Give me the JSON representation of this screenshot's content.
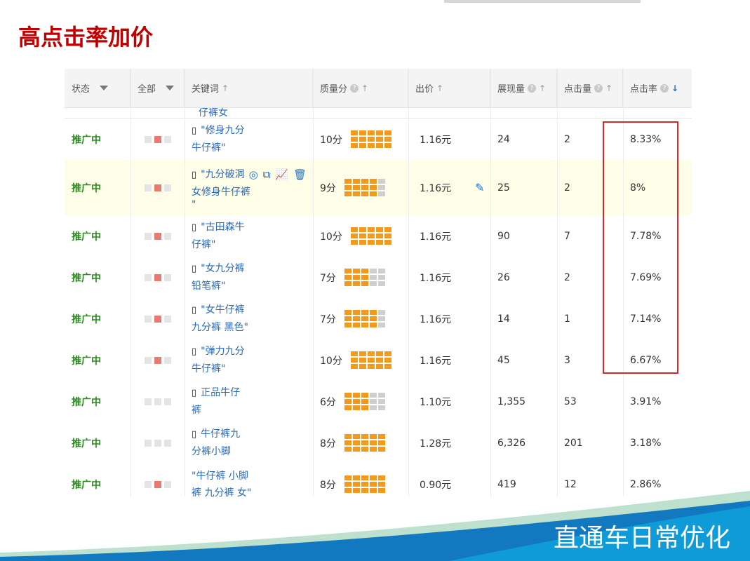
{
  "slide": {
    "title": "高点击率加价",
    "footer": "直通车日常优化"
  },
  "table": {
    "headers": {
      "status": "状态",
      "all": "全部",
      "keyword": "关键词",
      "quality": "质量分",
      "bid": "出价",
      "impressions": "展现量",
      "clicks": "点击量",
      "ctr": "点击率"
    },
    "partial_top_text": "仔裤女",
    "rows": [
      {
        "status": "推广中",
        "lights": [
          0,
          1,
          0
        ],
        "keyword1": "\"修身九分",
        "keyword2": "牛仔裤\"",
        "keyword3": "",
        "mobile": true,
        "quality": "10分",
        "qfill": 5,
        "bid": "1.16元",
        "impressions": "24",
        "clicks": "2",
        "ctr": "8.33%"
      },
      {
        "status": "推广中",
        "lights": [
          0,
          1,
          0
        ],
        "keyword1": "\"九分破洞",
        "keyword2": "女修身牛仔裤",
        "keyword3": "\"",
        "mobile": true,
        "quality": "9分",
        "qfill": 4,
        "bid": "1.16元",
        "impressions": "25",
        "clicks": "2",
        "ctr": "8%"
      },
      {
        "status": "推广中",
        "lights": [
          0,
          1,
          0
        ],
        "keyword1": "\"古田森牛",
        "keyword2": "仔裤\"",
        "keyword3": "",
        "mobile": true,
        "quality": "10分",
        "qfill": 5,
        "bid": "1.16元",
        "impressions": "90",
        "clicks": "7",
        "ctr": "7.78%"
      },
      {
        "status": "推广中",
        "lights": [
          0,
          1,
          0
        ],
        "keyword1": "\"女九分裤",
        "keyword2": "铅笔裤\"",
        "keyword3": "",
        "mobile": true,
        "quality": "7分",
        "qfill": 3,
        "bid": "1.16元",
        "impressions": "26",
        "clicks": "2",
        "ctr": "7.69%"
      },
      {
        "status": "推广中",
        "lights": [
          0,
          1,
          0
        ],
        "keyword1": "\"女牛仔裤",
        "keyword2": "九分裤 黑色\"",
        "keyword3": "",
        "mobile": true,
        "quality": "7分",
        "qfill": 4,
        "bid": "1.16元",
        "impressions": "14",
        "clicks": "1",
        "ctr": "7.14%"
      },
      {
        "status": "推广中",
        "lights": [
          0,
          1,
          0
        ],
        "keyword1": "\"弹力九分",
        "keyword2": "牛仔裤\"",
        "keyword3": "",
        "mobile": true,
        "quality": "10分",
        "qfill": 5,
        "bid": "1.16元",
        "impressions": "45",
        "clicks": "3",
        "ctr": "6.67%"
      },
      {
        "status": "推广中",
        "lights": [
          0,
          0,
          0
        ],
        "keyword1": "正品牛仔",
        "keyword2": "裤",
        "keyword3": "",
        "mobile": true,
        "quality": "6分",
        "qfill": 3,
        "bid": "1.10元",
        "impressions": "1,355",
        "clicks": "53",
        "ctr": "3.91%"
      },
      {
        "status": "推广中",
        "lights": [
          0,
          0,
          0
        ],
        "keyword1": "牛仔裤九",
        "keyword2": "分裤小脚",
        "keyword3": "",
        "mobile": true,
        "quality": "8分",
        "qfill": 5,
        "bid": "1.28元",
        "impressions": "6,326",
        "clicks": "201",
        "ctr": "3.18%"
      },
      {
        "status": "推广中",
        "lights": [
          0,
          1,
          0
        ],
        "keyword1": "\"牛仔裤 小脚",
        "keyword2": "裤 九分裤 女\"",
        "keyword3": "",
        "mobile": false,
        "quality": "8分",
        "qfill": 5,
        "bid": "0.90元",
        "impressions": "419",
        "clicks": "12",
        "ctr": "2.86%"
      }
    ]
  },
  "colors": {
    "title_red": "#c00000",
    "status_green": "#2e8b22",
    "keyword_blue": "#2a69b5",
    "quality_orange": "#f39a1c",
    "highlight_red": "#d22a2a",
    "footer_blue": "#1278c0"
  },
  "icons": [
    "mobile-icon",
    "target-icon",
    "export-icon",
    "chart-icon",
    "trash-icon",
    "pencil-icon"
  ]
}
